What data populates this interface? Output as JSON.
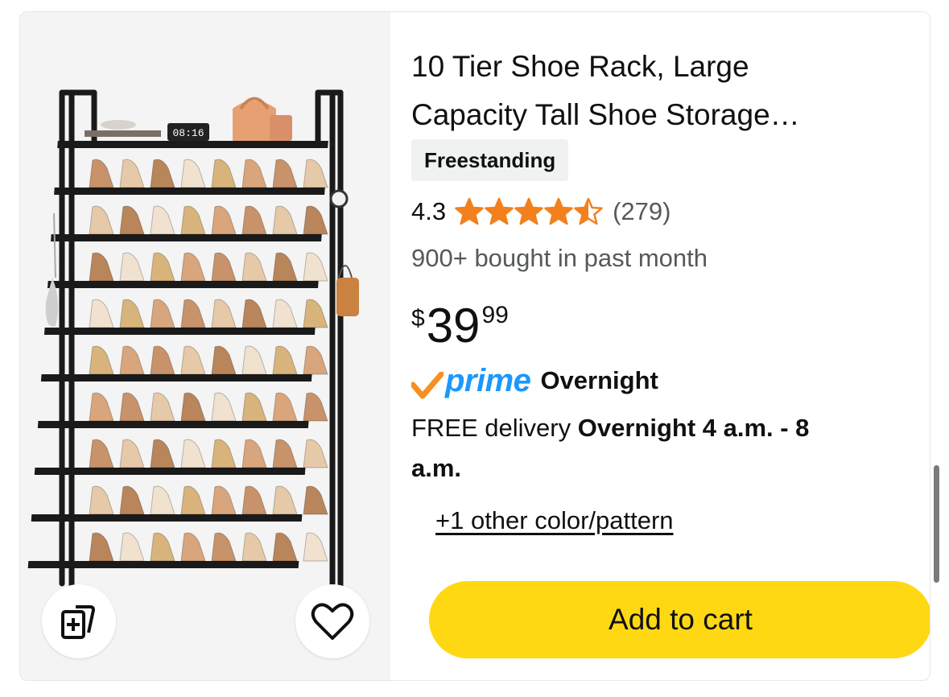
{
  "product": {
    "title_line1": "10 Tier Shoe Rack, Large",
    "title_line2": "Capacity Tall Shoe Storage…",
    "badge": "Freestanding",
    "rating_value": "4.3",
    "rating_stars": 4.3,
    "rating_max": 5,
    "rating_count": "(279)",
    "bought_text": "900+ bought in past month",
    "price": {
      "symbol": "$",
      "whole": "39",
      "fraction": "99"
    },
    "prime": {
      "label": "prime",
      "speed": "Overnight"
    },
    "delivery": {
      "prefix": "FREE delivery",
      "window": "Overnight 4 a.m. - 8 a.m."
    },
    "variant_link": "+1 other color/pattern",
    "add_to_cart_label": "Add to cart",
    "clock_display": "08:16"
  },
  "icons": {
    "compare": "compare-icon",
    "wishlist": "heart-icon",
    "star": "star-icon"
  },
  "colors": {
    "star": "#f3801c",
    "prime_blue": "#1a98ff",
    "prime_check": "#f7901e",
    "cart_button": "#ffd814",
    "badge_bg": "#f0f2f2",
    "secondary_text": "#565959"
  }
}
